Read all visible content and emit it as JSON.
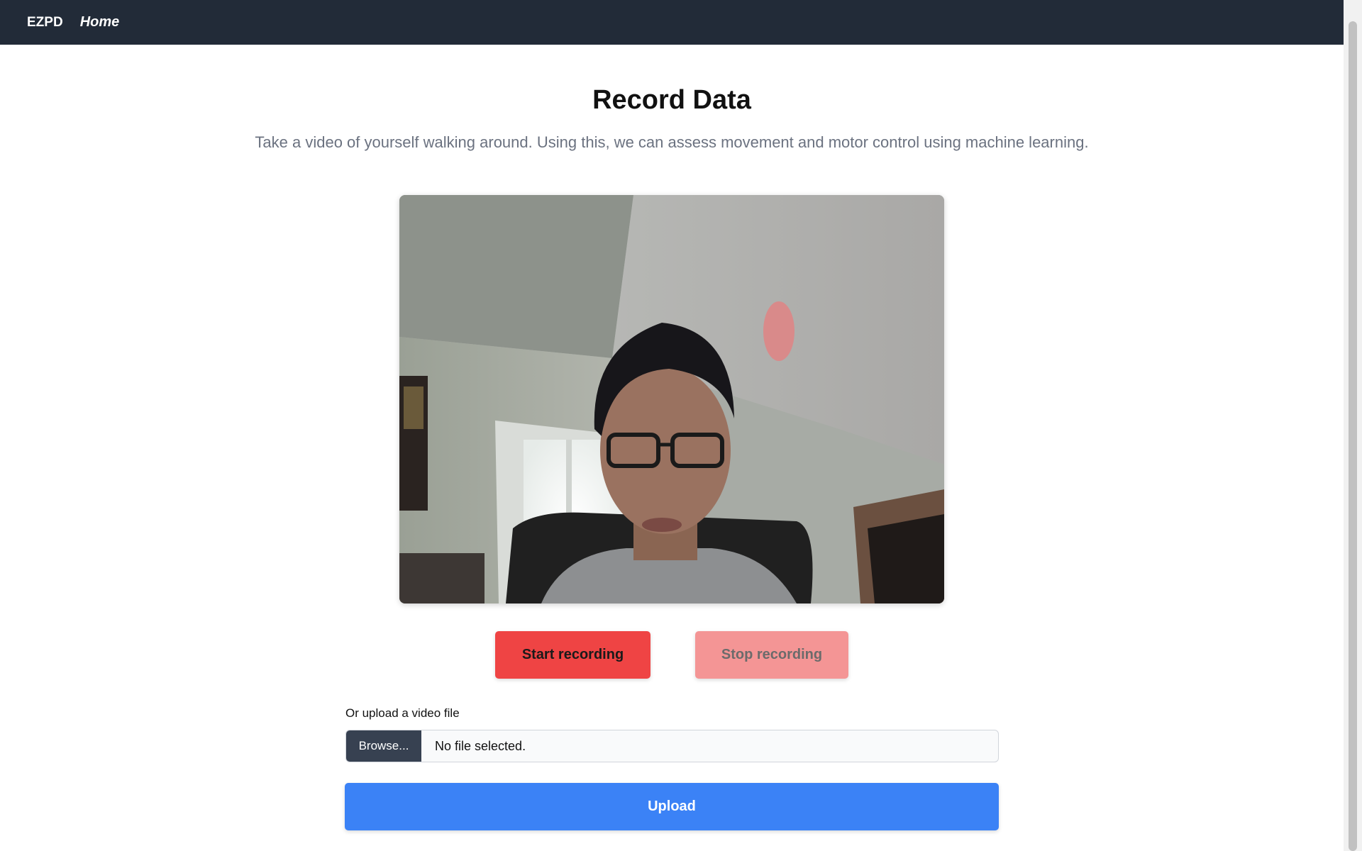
{
  "navbar": {
    "brand": "EZPD",
    "home_link": "Home"
  },
  "page": {
    "title": "Record Data",
    "subtitle": "Take a video of yourself walking around. Using this, we can assess movement and motor control using machine learning."
  },
  "recording": {
    "start_label": "Start recording",
    "stop_label": "Stop recording"
  },
  "upload": {
    "label": "Or upload a video file",
    "browse_label": "Browse...",
    "file_status": "No file selected.",
    "submit_label": "Upload"
  },
  "colors": {
    "navbar_bg": "#222b38",
    "start_button": "#ef4444",
    "stop_button_disabled": "#f49595",
    "upload_button": "#3b82f6",
    "browse_button": "#374151"
  }
}
